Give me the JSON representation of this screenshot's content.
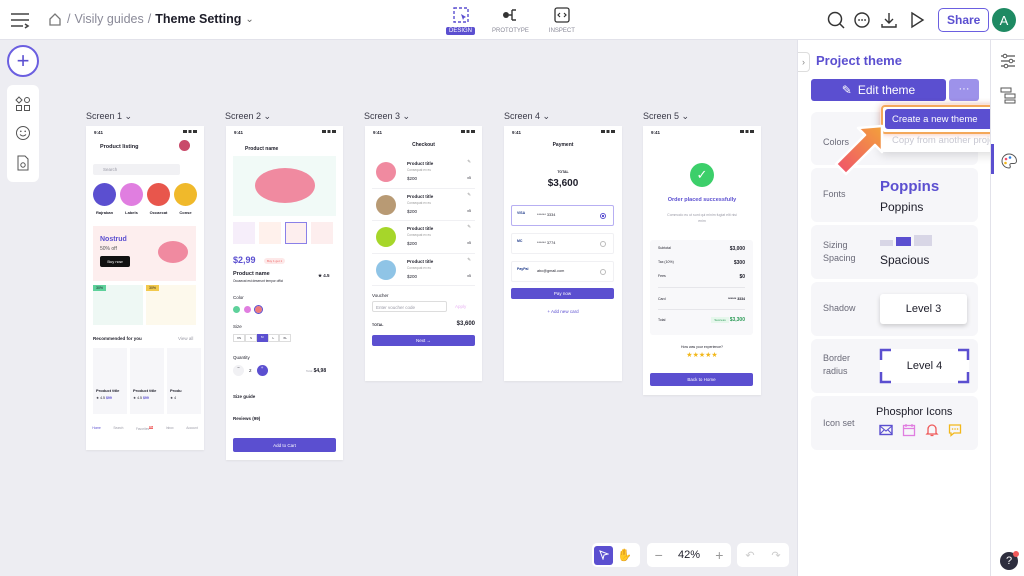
{
  "topbar": {
    "breadcrumb_parent": "Visily guides",
    "breadcrumb_current": "Theme Setting",
    "modes": [
      {
        "label": "DESIGN",
        "active": true
      },
      {
        "label": "PROTOTYPE",
        "active": false
      },
      {
        "label": "INSPECT",
        "active": false
      }
    ],
    "share_label": "Share",
    "avatar_initial": "A",
    "icons": [
      "menu-icon",
      "home-icon",
      "search-icon",
      "comment-icon",
      "download-icon",
      "play-icon"
    ]
  },
  "toolbar": {
    "icons": [
      "plus-icon",
      "components-icon",
      "emoji-icon",
      "file-icon"
    ]
  },
  "screens": [
    {
      "label": "Screen 1",
      "time": "9:41",
      "title": "Product listing",
      "search_placeholder": "Search",
      "categories": [
        "Rajraban",
        "Labels",
        "Occaecat",
        "Conse"
      ],
      "banner": {
        "title": "Nostrud",
        "subtitle": "50% off",
        "button": "Buy now"
      },
      "tiles": [
        "30%",
        "30%"
      ],
      "section": "Recommended for you",
      "view_all": "View all",
      "products": [
        {
          "title": "Product title",
          "rating": "4.5",
          "price": "$99"
        },
        {
          "title": "Product title",
          "rating": "4.5",
          "price": "$99"
        },
        {
          "title": "Produ",
          "rating": "4",
          "price": ""
        }
      ],
      "nav": [
        "Home",
        "Search",
        "Favorites",
        "Inbox",
        "Account"
      ],
      "badge": "99+"
    },
    {
      "label": "Screen 2",
      "time": "9:41",
      "title": "Product name",
      "price": "$2,99",
      "promo": "Buy 1 get 1",
      "name": "Product name",
      "rating": "4.5",
      "desc": "Occaecat est deserunt tempor offici",
      "color_label": "Color",
      "size_label": "Size",
      "sizes": [
        "XS",
        "S",
        "M",
        "L",
        "XL"
      ],
      "selected_size": "M",
      "quantity_label": "Quantity",
      "quantity": "2",
      "total_label": "Total",
      "total": "$4,98",
      "size_guide": "Size guide",
      "reviews": "Reviews (99)",
      "cta": "Add to Cart"
    },
    {
      "label": "Screen 3",
      "time": "9:41",
      "title": "Checkout",
      "items": [
        {
          "title": "Product title",
          "sub": "Consequat ex eu",
          "price": "$200",
          "qty": "x5",
          "color": "#f08aa0"
        },
        {
          "title": "Product title",
          "sub": "Consequat ex eu",
          "price": "$200",
          "qty": "x5",
          "color": "#b89a74"
        },
        {
          "title": "Product title",
          "sub": "Consequat ex eu",
          "price": "$200",
          "qty": "x5",
          "color": "#a6d62a"
        },
        {
          "title": "Product title",
          "sub": "Consequat ex eu",
          "price": "$200",
          "qty": "x5",
          "color": "#8fc4e6"
        }
      ],
      "voucher_label": "Voucher",
      "voucher_placeholder": "Enter voucher code",
      "apply": "Apply",
      "total_label": "TOTAL",
      "total": "$3,600",
      "next": "Next →"
    },
    {
      "label": "Screen 4",
      "time": "9:41",
      "title": "Payment",
      "total_label": "TOTAL",
      "total": "$3,600",
      "methods": [
        {
          "brand": "VISA",
          "text": "****** 3334",
          "selected": true
        },
        {
          "brand": "MC",
          "text": "****** 3774",
          "selected": false
        },
        {
          "brand": "PayPal",
          "text": "abc@gmail.com",
          "selected": false
        }
      ],
      "pay": "Pay now",
      "add_card": "+ Add new card"
    },
    {
      "label": "Screen 5",
      "time": "9:41",
      "title": "Order placed successfully",
      "desc": "Commodo eu ut sunt qui minim fugiat elit nisi enim",
      "rows": [
        {
          "k": "Subtotal",
          "v": "$3,000"
        },
        {
          "k": "Tax (10%)",
          "v": "$300"
        },
        {
          "k": "Fees",
          "v": "$0"
        }
      ],
      "card_label": "Card",
      "card_value": "****** 3334",
      "total_label": "Total",
      "status": "Success",
      "total": "$3,300",
      "experience": "How was your experience?",
      "stars": 5,
      "cta": "Back to Home"
    }
  ],
  "bottom": {
    "zoom": "42%"
  },
  "panel": {
    "title": "Project theme",
    "edit": "Edit theme",
    "more": "···",
    "menu": [
      "Create a new theme",
      "Copy from another project"
    ],
    "colors_label": "Colors",
    "fonts_label": "Fonts",
    "font_heading": "Poppins",
    "font_body": "Poppins",
    "sizing_label": "Sizing Spacing",
    "sizing_value": "Spacious",
    "shadow_label": "Shadow",
    "shadow_value": "Level 3",
    "radius_label": "Border radius",
    "radius_value": "Level 4",
    "iconset_label": "Icon set",
    "iconset_value": "Phosphor Icons"
  },
  "colors": {
    "accent": "#5b4fd0",
    "canvas": "#ededf2",
    "highlight": "#f4a85a"
  }
}
